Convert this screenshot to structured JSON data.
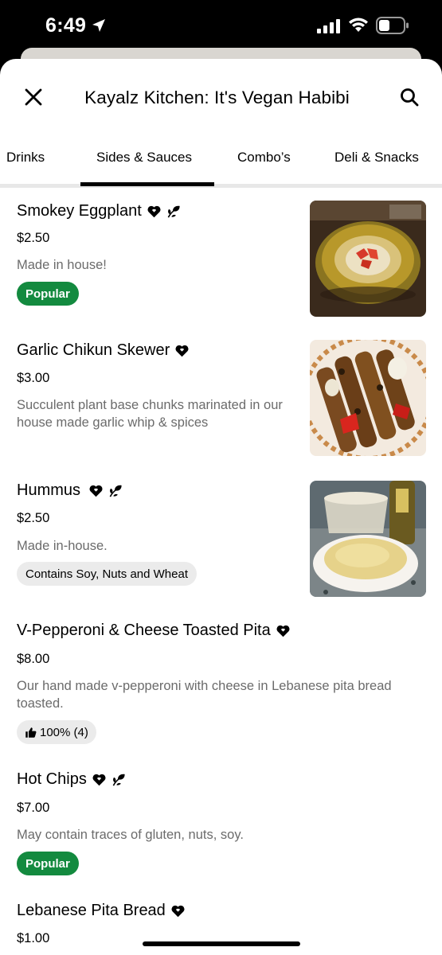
{
  "status_bar": {
    "time": "6:49"
  },
  "header": {
    "title": "Kayalz Kitchen: It's Vegan Habibi"
  },
  "tabs": [
    {
      "label": "Drinks"
    },
    {
      "label": "Sides & Sauces",
      "active": true
    },
    {
      "label": "Combo’s"
    },
    {
      "label": "Deli & Snacks"
    }
  ],
  "items": [
    {
      "name": "Smokey Eggplant",
      "icons": [
        "heart-icon",
        "leaf-icon"
      ],
      "price": "$2.50",
      "description": "Made in house!",
      "badge": "Popular"
    },
    {
      "name": "Garlic Chikun Skewer",
      "icons": [
        "heart-icon"
      ],
      "price": "$3.00",
      "description": "Succulent plant base chunks marinated in our house made garlic whip & spices"
    },
    {
      "name": "Hummus",
      "icons": [
        "heart-icon",
        "leaf-icon"
      ],
      "price": "$2.50",
      "description": "Made in-house.",
      "badge": "Contains Soy, Nuts and Wheat"
    },
    {
      "name": "V-Pepperoni & Cheese Toasted Pita",
      "icons": [
        "heart-icon"
      ],
      "price": "$8.00",
      "description": "Our hand made v-pepperoni with cheese in Lebanese pita bread toasted.",
      "rating": "100% (4)"
    },
    {
      "name": "Hot Chips",
      "icons": [
        "heart-icon",
        "leaf-icon"
      ],
      "price": "$7.00",
      "description": "May contain traces of gluten, nuts, soy.",
      "badge": "Popular"
    },
    {
      "name": "Lebanese Pita Bread",
      "icons": [
        "heart-icon"
      ],
      "price": "$1.00"
    }
  ],
  "colors": {
    "popular_badge": "#138a3f",
    "description_text": "#6b6b6b",
    "tab_divider": "#e8e8e8"
  }
}
